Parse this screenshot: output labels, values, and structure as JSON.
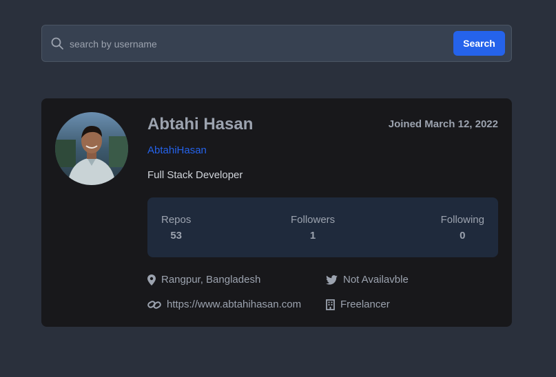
{
  "search": {
    "placeholder": "search by username",
    "button_label": "Search"
  },
  "profile": {
    "name": "Abtahi Hasan",
    "joined": "Joined March 12, 2022",
    "username": "AbtahiHasan",
    "bio": "Full Stack Developer"
  },
  "stats": [
    {
      "label": "Repos",
      "value": "53"
    },
    {
      "label": "Followers",
      "value": "1"
    },
    {
      "label": "Following",
      "value": "0"
    }
  ],
  "info": {
    "location": "Rangpur, Bangladesh",
    "twitter": "Not Availavble",
    "website": "https://www.abtahihasan.com",
    "company": "Freelancer"
  },
  "colors": {
    "page_bg": "#2a303c",
    "card_bg": "#18181b",
    "stats_bg": "#1f2a3c",
    "accent": "#2563eb"
  }
}
